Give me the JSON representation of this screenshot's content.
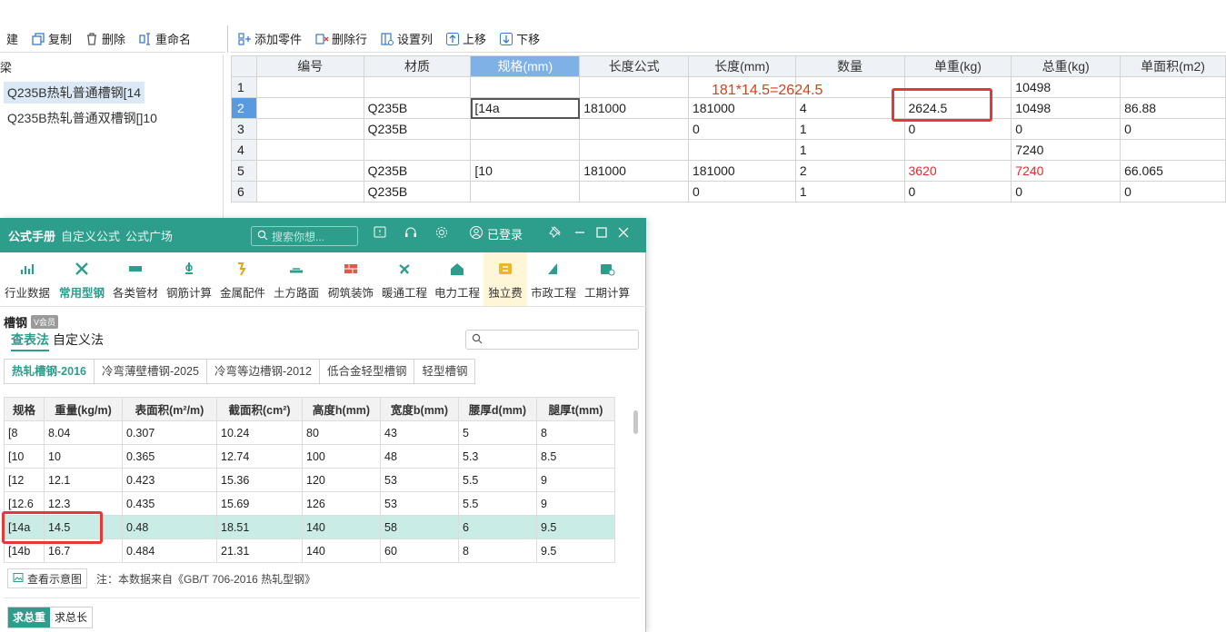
{
  "left_toolbar": {
    "new_label": "建",
    "copy_label": "复制",
    "delete_label": "删除",
    "rename_label": "重命名"
  },
  "left_panel": {
    "group_label": "梁",
    "items": [
      {
        "label": "Q235B热轧普通槽钢[14"
      },
      {
        "label": "Q235B热轧普通双槽钢[]10"
      }
    ]
  },
  "right_toolbar": {
    "add_part": "添加零件",
    "delete_row": "删除行",
    "set_columns": "设置列",
    "move_up": "上移",
    "move_down": "下移"
  },
  "grid": {
    "headers": [
      "",
      "编号",
      "材质",
      "规格(mm)",
      "长度公式",
      "长度(mm)",
      "数量",
      "单重(kg)",
      "总重(kg)",
      "单面积(m2)"
    ],
    "rows": [
      [
        "1",
        "",
        "",
        "",
        "",
        "",
        "",
        "",
        "10498",
        ""
      ],
      [
        "2",
        "",
        "Q235B",
        "[14a",
        "181000",
        "181000",
        "4",
        "2624.5",
        "10498",
        "86.88"
      ],
      [
        "3",
        "",
        "Q235B",
        "",
        "",
        "0",
        "1",
        "0",
        "0",
        "0"
      ],
      [
        "4",
        "",
        "",
        "",
        "",
        "",
        "1",
        "",
        "7240",
        ""
      ],
      [
        "5",
        "",
        "Q235B",
        "[10",
        "181000",
        "181000",
        "2",
        "3620",
        "7240",
        "66.065"
      ],
      [
        "6",
        "",
        "Q235B",
        "",
        "",
        "0",
        "1",
        "0",
        "0",
        "0"
      ]
    ]
  },
  "annotation": "181*14.5=2624.5",
  "popup": {
    "tabs": [
      "公式手册",
      "自定义公式",
      "公式广场"
    ],
    "search_placeholder": "搜索你想...",
    "login_status": "已登录",
    "categories": [
      {
        "label": "行业数据",
        "icon": "industry-data-icon"
      },
      {
        "label": "常用型钢",
        "icon": "section-steel-icon"
      },
      {
        "label": "各类管材",
        "icon": "pipe-icon"
      },
      {
        "label": "钢筋计算",
        "icon": "rebar-icon"
      },
      {
        "label": "金属配件",
        "icon": "metal-fitting-icon"
      },
      {
        "label": "土方路面",
        "icon": "earthwork-icon"
      },
      {
        "label": "砌筑装饰",
        "icon": "masonry-icon"
      },
      {
        "label": "暖通工程",
        "icon": "hvac-icon"
      },
      {
        "label": "电力工程",
        "icon": "power-icon"
      },
      {
        "label": "独立费",
        "icon": "fee-icon"
      },
      {
        "label": "市政工程",
        "icon": "municipal-icon"
      },
      {
        "label": "工期计算",
        "icon": "schedule-icon"
      }
    ],
    "section_title": "槽钢",
    "section_badge": "V会员",
    "methods": [
      "查表法",
      "自定义法"
    ],
    "standards": [
      "热轧槽钢-2016",
      "冷弯薄壁槽钢-2025",
      "冷弯等边槽钢-2012",
      "低合金轻型槽钢",
      "轻型槽钢"
    ],
    "steel_headers": [
      "规格",
      "重量(kg/m)",
      "表面积(m²/m)",
      "截面积(cm²)",
      "高度h(mm)",
      "宽度b(mm)",
      "腰厚d(mm)",
      "腿厚t(mm)"
    ],
    "steel_rows": [
      [
        "[8",
        "8.04",
        "0.307",
        "10.24",
        "80",
        "43",
        "5",
        "8"
      ],
      [
        "[10",
        "10",
        "0.365",
        "12.74",
        "100",
        "48",
        "5.3",
        "8.5"
      ],
      [
        "[12",
        "12.1",
        "0.423",
        "15.36",
        "120",
        "53",
        "5.5",
        "9"
      ],
      [
        "[12.6",
        "12.3",
        "0.435",
        "15.69",
        "126",
        "53",
        "5.5",
        "9"
      ],
      [
        "[14a",
        "14.5",
        "0.48",
        "18.51",
        "140",
        "58",
        "6",
        "9.5"
      ],
      [
        "[14b",
        "16.7",
        "0.484",
        "21.31",
        "140",
        "60",
        "8",
        "9.5"
      ]
    ],
    "diagram_button": "查看示意图",
    "note": "注：本数据来自《GB/T 706-2016 热轧型钢》",
    "calc_tabs": [
      "求总重",
      "求总长"
    ]
  },
  "colors": {
    "teal": "#2d9d8c",
    "red_mark": "#e53935",
    "selected_header": "#7fb0e6"
  }
}
